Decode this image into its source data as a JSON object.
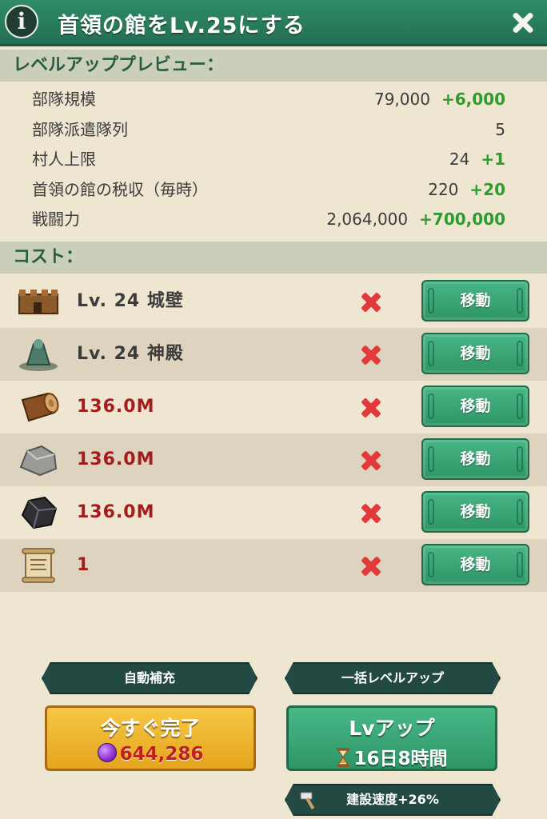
{
  "header": {
    "info_icon_glyph": "i",
    "title": "首領の館をLv.25にする"
  },
  "preview": {
    "heading": "レベルアッププレビュー：",
    "stats": [
      {
        "label": "部隊規模",
        "value": "79,000",
        "increase": "+6,000"
      },
      {
        "label": "部隊派遣隊列",
        "value": "5",
        "increase": ""
      },
      {
        "label": "村人上限",
        "value": "24",
        "increase": "+1"
      },
      {
        "label": "首領の館の税収（毎時）",
        "value": "220",
        "increase": "+20"
      },
      {
        "label": "戦闘力",
        "value": "2,064,000",
        "increase": "+700,000"
      }
    ]
  },
  "cost": {
    "heading": "コスト：",
    "items": [
      {
        "icon": "wall-icon",
        "text": "Lv. 24  城壁",
        "move_label": "移動"
      },
      {
        "icon": "temple-icon",
        "text": "Lv. 24  神殿",
        "move_label": "移動"
      },
      {
        "icon": "wood-log-icon",
        "text": "136.0M",
        "move_label": "移動"
      },
      {
        "icon": "stone-icon",
        "text": "136.0M",
        "move_label": "移動"
      },
      {
        "icon": "iron-ore-icon",
        "text": "136.0M",
        "move_label": "移動"
      },
      {
        "icon": "scroll-icon",
        "text": "1",
        "move_label": "移動"
      }
    ]
  },
  "actions": {
    "auto_refill": "自動補充",
    "bulk_level_up": "一括レベルアップ",
    "instant_complete": "今すぐ完了",
    "gem_cost": "644,286",
    "level_up": "Lvアップ",
    "duration": "16日8時間",
    "build_speed": "建設速度+26%"
  },
  "colors": {
    "header_green": "#2f8c69",
    "increase_green": "#2f9a2f",
    "shortage_red": "#a31d1d",
    "cross_red": "#e2393c",
    "gold_button": "#f6c745",
    "green_button": "#48b888"
  }
}
